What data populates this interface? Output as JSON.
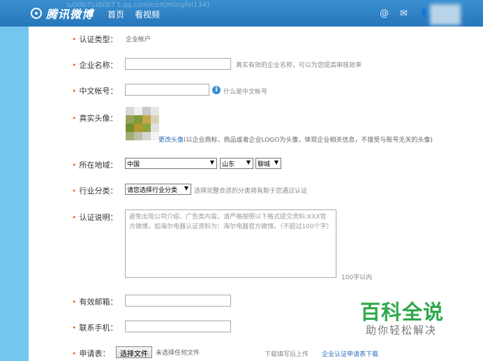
{
  "header": {
    "brand": "腾讯微博",
    "nav": [
      "首页",
      "看视频"
    ],
    "url_fragment": "\\u00b7\\u00b7 t.qq.com/cert/mingfei134)",
    "icons": [
      "at-icon",
      "mail-icon",
      "user-icon"
    ],
    "at_glyph": "@",
    "mail_glyph": "✉",
    "user_glyph": "👤"
  },
  "form": {
    "cert_type": {
      "label": "认证类型：",
      "value": "企业帐户"
    },
    "company_name": {
      "label": "企业名称：",
      "value": "",
      "hint": "真实有效的企业名称，可以为您提高审核效率"
    },
    "cn_account": {
      "label": "中文帐号：",
      "value": "",
      "info_glyph": "i",
      "hint": "什么是中文帐号"
    },
    "avatar": {
      "label": "真实头像：",
      "change_link": "更改头像",
      "hint": "(以企业商标、商品或者企业LOGO为头像，体现企业相关信息，不接受与账号无关的头像)"
    },
    "region": {
      "label": "所在地域：",
      "country": "中国",
      "province": "山东",
      "city": "聊城"
    },
    "industry": {
      "label": "行业分类：",
      "selected": "请您选择行业分类",
      "hint": "选择完整合适的分类将有助于您通过认证"
    },
    "description": {
      "label": "认证说明：",
      "placeholder": "避免出现公司介绍、广告类内容。请严格按照以下格式提交资料:XXX官方微博，如海尔电器认证资料为：海尔电器官方微博。（不超过100个字）",
      "limit_hint": "100字以内"
    },
    "email": {
      "label": "有效邮箱：",
      "value": ""
    },
    "phone": {
      "label": "联系手机：",
      "value": ""
    },
    "application": {
      "label": "申请表：",
      "choose_button": "选择文件",
      "no_file": "未选择任何文件",
      "download_hint": "下载填写后上传",
      "download_link": "企业认证申请表下载"
    }
  },
  "required_mark": "•",
  "arrow_glyph": "▼",
  "watermark": {
    "main": "百科全说",
    "sub": "助你轻松解决"
  },
  "colors": {
    "header": "#2c7fc4",
    "side": "#74c6ee",
    "required": "#f26b1d",
    "link": "#2a6fb8",
    "watermark": "#2ea84a"
  }
}
